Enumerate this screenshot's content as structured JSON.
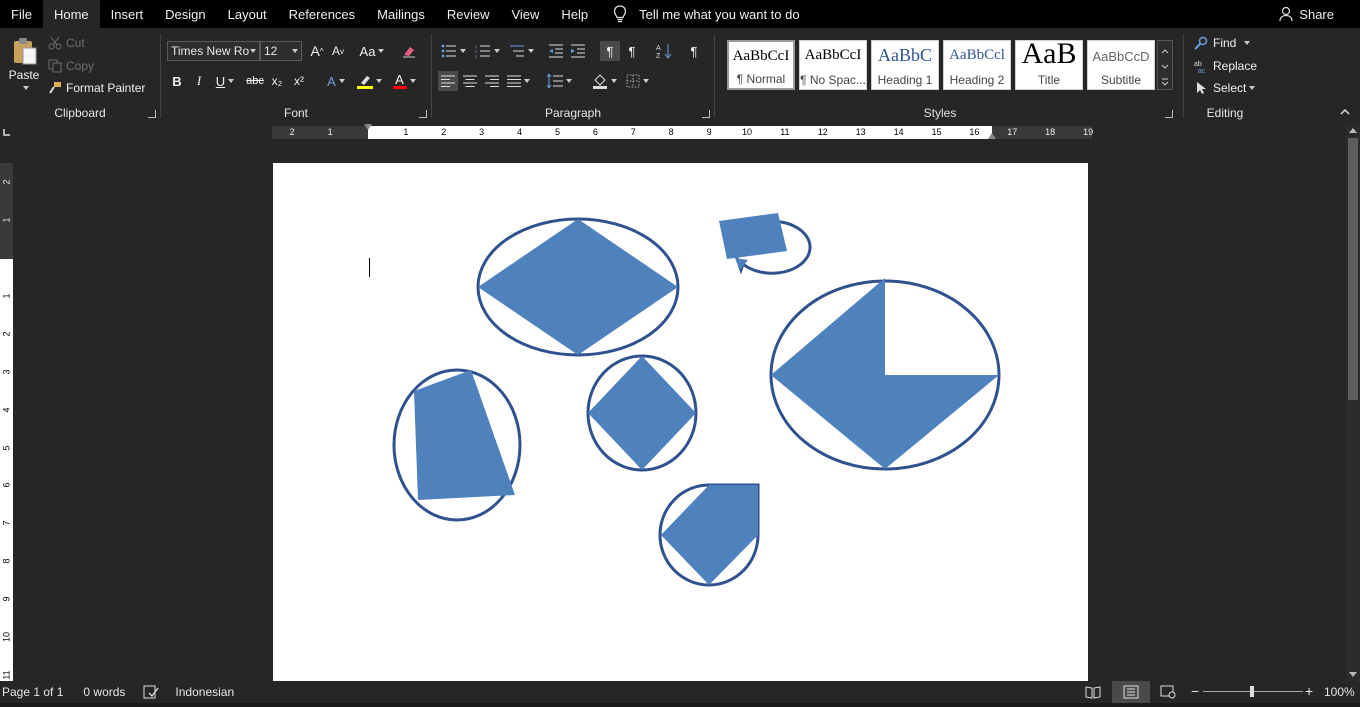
{
  "menu": {
    "tabs": [
      "File",
      "Home",
      "Insert",
      "Design",
      "Layout",
      "References",
      "Mailings",
      "Review",
      "View",
      "Help"
    ],
    "active_tab": "Home",
    "tell_me": "Tell me what you want to do",
    "share": "Share"
  },
  "clipboard": {
    "paste": "Paste",
    "cut": "Cut",
    "copy": "Copy",
    "format_painter": "Format Painter",
    "label": "Clipboard"
  },
  "font": {
    "family": "Times New Ro",
    "size": "12",
    "label": "Font",
    "grow": "A",
    "shrink": "A",
    "case": "Aa",
    "bold": "B",
    "italic": "I",
    "underline": "U",
    "strike": "abc",
    "subscript": "x₂",
    "superscript": "x²",
    "text_effects": "A",
    "font_color": "A",
    "highlight_color": "#ffff00",
    "font_color_value": "#ff0000"
  },
  "paragraph": {
    "label": "Paragraph",
    "pilcrow": "¶"
  },
  "styles": {
    "label": "Styles",
    "items": [
      {
        "sample": "AaBbCcI",
        "name": "¶ Normal"
      },
      {
        "sample": "AaBbCcI",
        "name": "¶ No Spac..."
      },
      {
        "sample": "AaBbC",
        "name": "Heading 1"
      },
      {
        "sample": "AaBbCcl",
        "name": "Heading 2"
      },
      {
        "sample": "AaB",
        "name": "Title"
      },
      {
        "sample": "AaBbCcD",
        "name": "Subtitle"
      }
    ]
  },
  "editing": {
    "label": "Editing",
    "find": "Find",
    "replace": "Replace",
    "select": "Select"
  },
  "ruler": {
    "h_left_numbers": [
      "2",
      "1"
    ],
    "h_numbers": [
      "1",
      "2",
      "3",
      "4",
      "5",
      "6",
      "7",
      "8",
      "9",
      "10",
      "11",
      "12",
      "13",
      "14",
      "15",
      "16",
      "17",
      "18",
      "19"
    ],
    "v_top_numbers": [
      "2",
      "1"
    ],
    "v_numbers": [
      "1",
      "2",
      "3",
      "4",
      "5",
      "6",
      "7",
      "8",
      "9",
      "10",
      "11"
    ]
  },
  "status": {
    "page": "Page 1 of 1",
    "words": "0 words",
    "language": "Indonesian",
    "zoom": "100%"
  },
  "shape_color": "#4f81bd",
  "shape_outline": "#2f528f"
}
